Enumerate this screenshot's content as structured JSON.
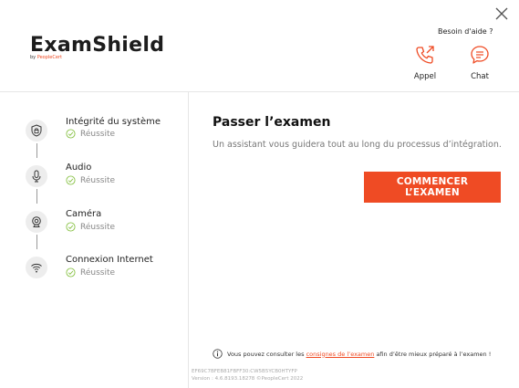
{
  "app": {
    "logo_title": "ExamShield",
    "logo_by": "by ",
    "logo_brand": "PeopleCert",
    "brand_color": "#ef4b24"
  },
  "help": {
    "title": "Besoin d'aide ?",
    "call_label": "Appel",
    "call_icon": "phone-outgoing-icon",
    "chat_label": "Chat",
    "chat_icon": "chat-bubble-icon"
  },
  "steps": [
    {
      "title": "Intégrité du système",
      "status": "Réussite",
      "icon": "lock-shield-icon"
    },
    {
      "title": "Audio",
      "status": "Réussite",
      "icon": "microphone-icon"
    },
    {
      "title": "Caméra",
      "status": "Réussite",
      "icon": "webcam-icon"
    },
    {
      "title": "Connexion Internet",
      "status": "Réussite",
      "icon": "wifi-icon"
    }
  ],
  "main": {
    "title": "Passer l’examen",
    "subtitle": "Un assistant vous guidera tout au long du processus d’intégration.",
    "start_button": "COMMENCER L’EXAMEN",
    "info_prefix": "Vous pouvez consulter les ",
    "info_link": "consignes de l’examen",
    "info_suffix": " afin d’être mieux préparé à l’examen !"
  },
  "footer": {
    "id_line": "EF69C7BFEB81FBFF30:CW5B5YCB0HTYFP",
    "version_line": "Version : 4.6.8193.18278 ©PeopleCert 2022"
  }
}
